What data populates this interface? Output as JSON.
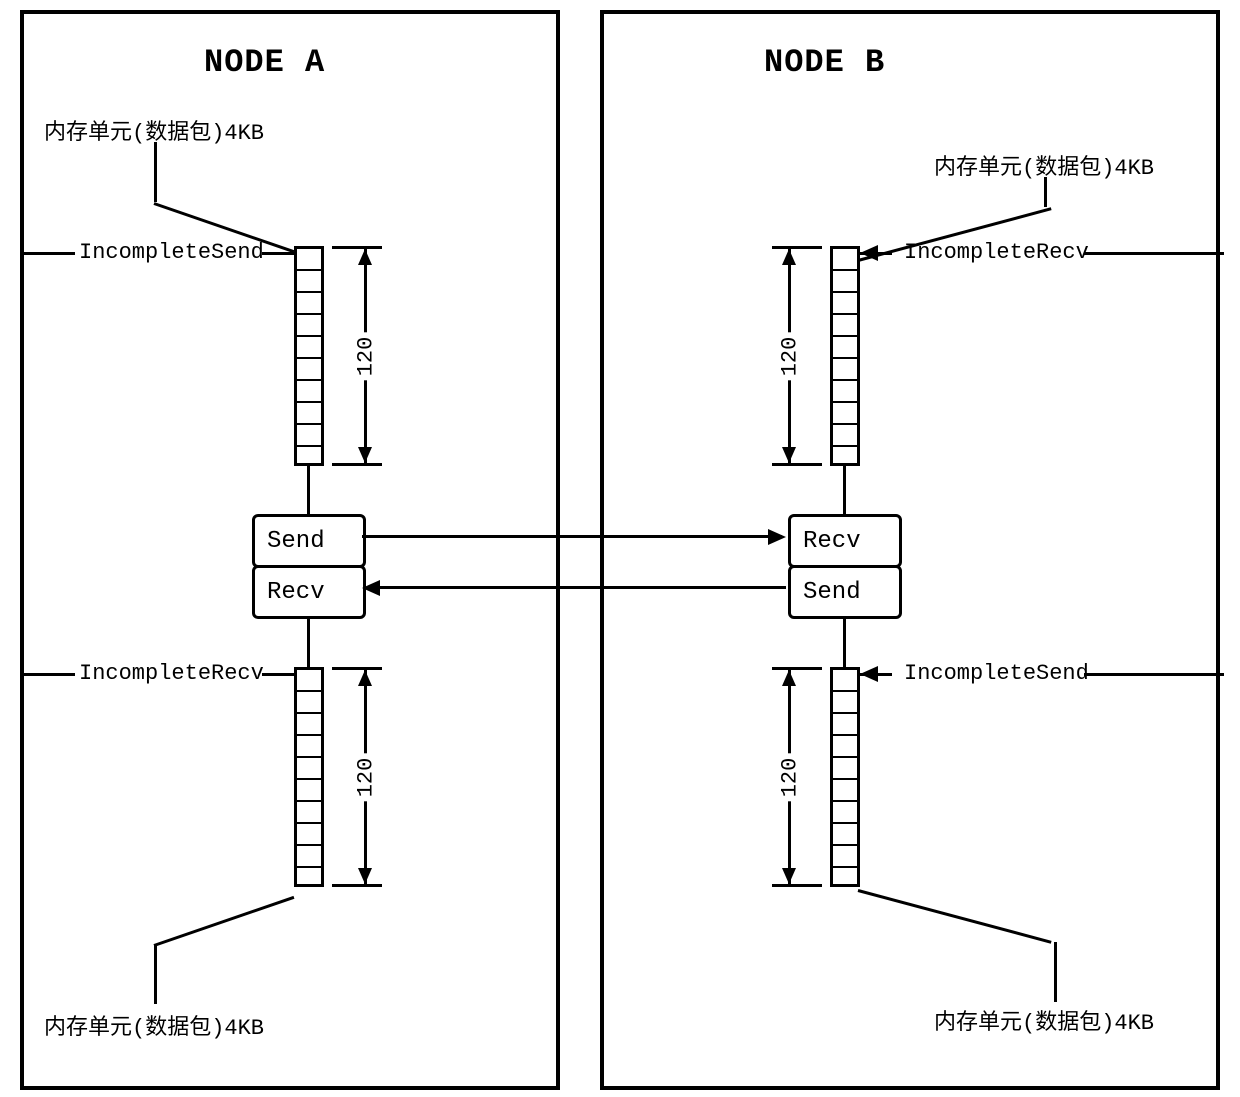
{
  "node_a": {
    "title": "NODE A",
    "mem_top": "内存单元(数据包)4KB",
    "mem_bottom": "内存单元(数据包)4KB",
    "incomplete_send": "IncompleteSend",
    "incomplete_recv": "IncompleteRecv",
    "send": "Send",
    "recv": "Recv",
    "dim_top": "120",
    "dim_bottom": "120"
  },
  "node_b": {
    "title": "NODE B",
    "mem_top": "内存单元(数据包)4KB",
    "mem_bottom": "内存单元(数据包)4KB",
    "incomplete_recv": "IncompleteRecv",
    "incomplete_send": "IncompleteSend",
    "recv": "Recv",
    "send": "Send",
    "dim_top": "120",
    "dim_bottom": "120"
  }
}
